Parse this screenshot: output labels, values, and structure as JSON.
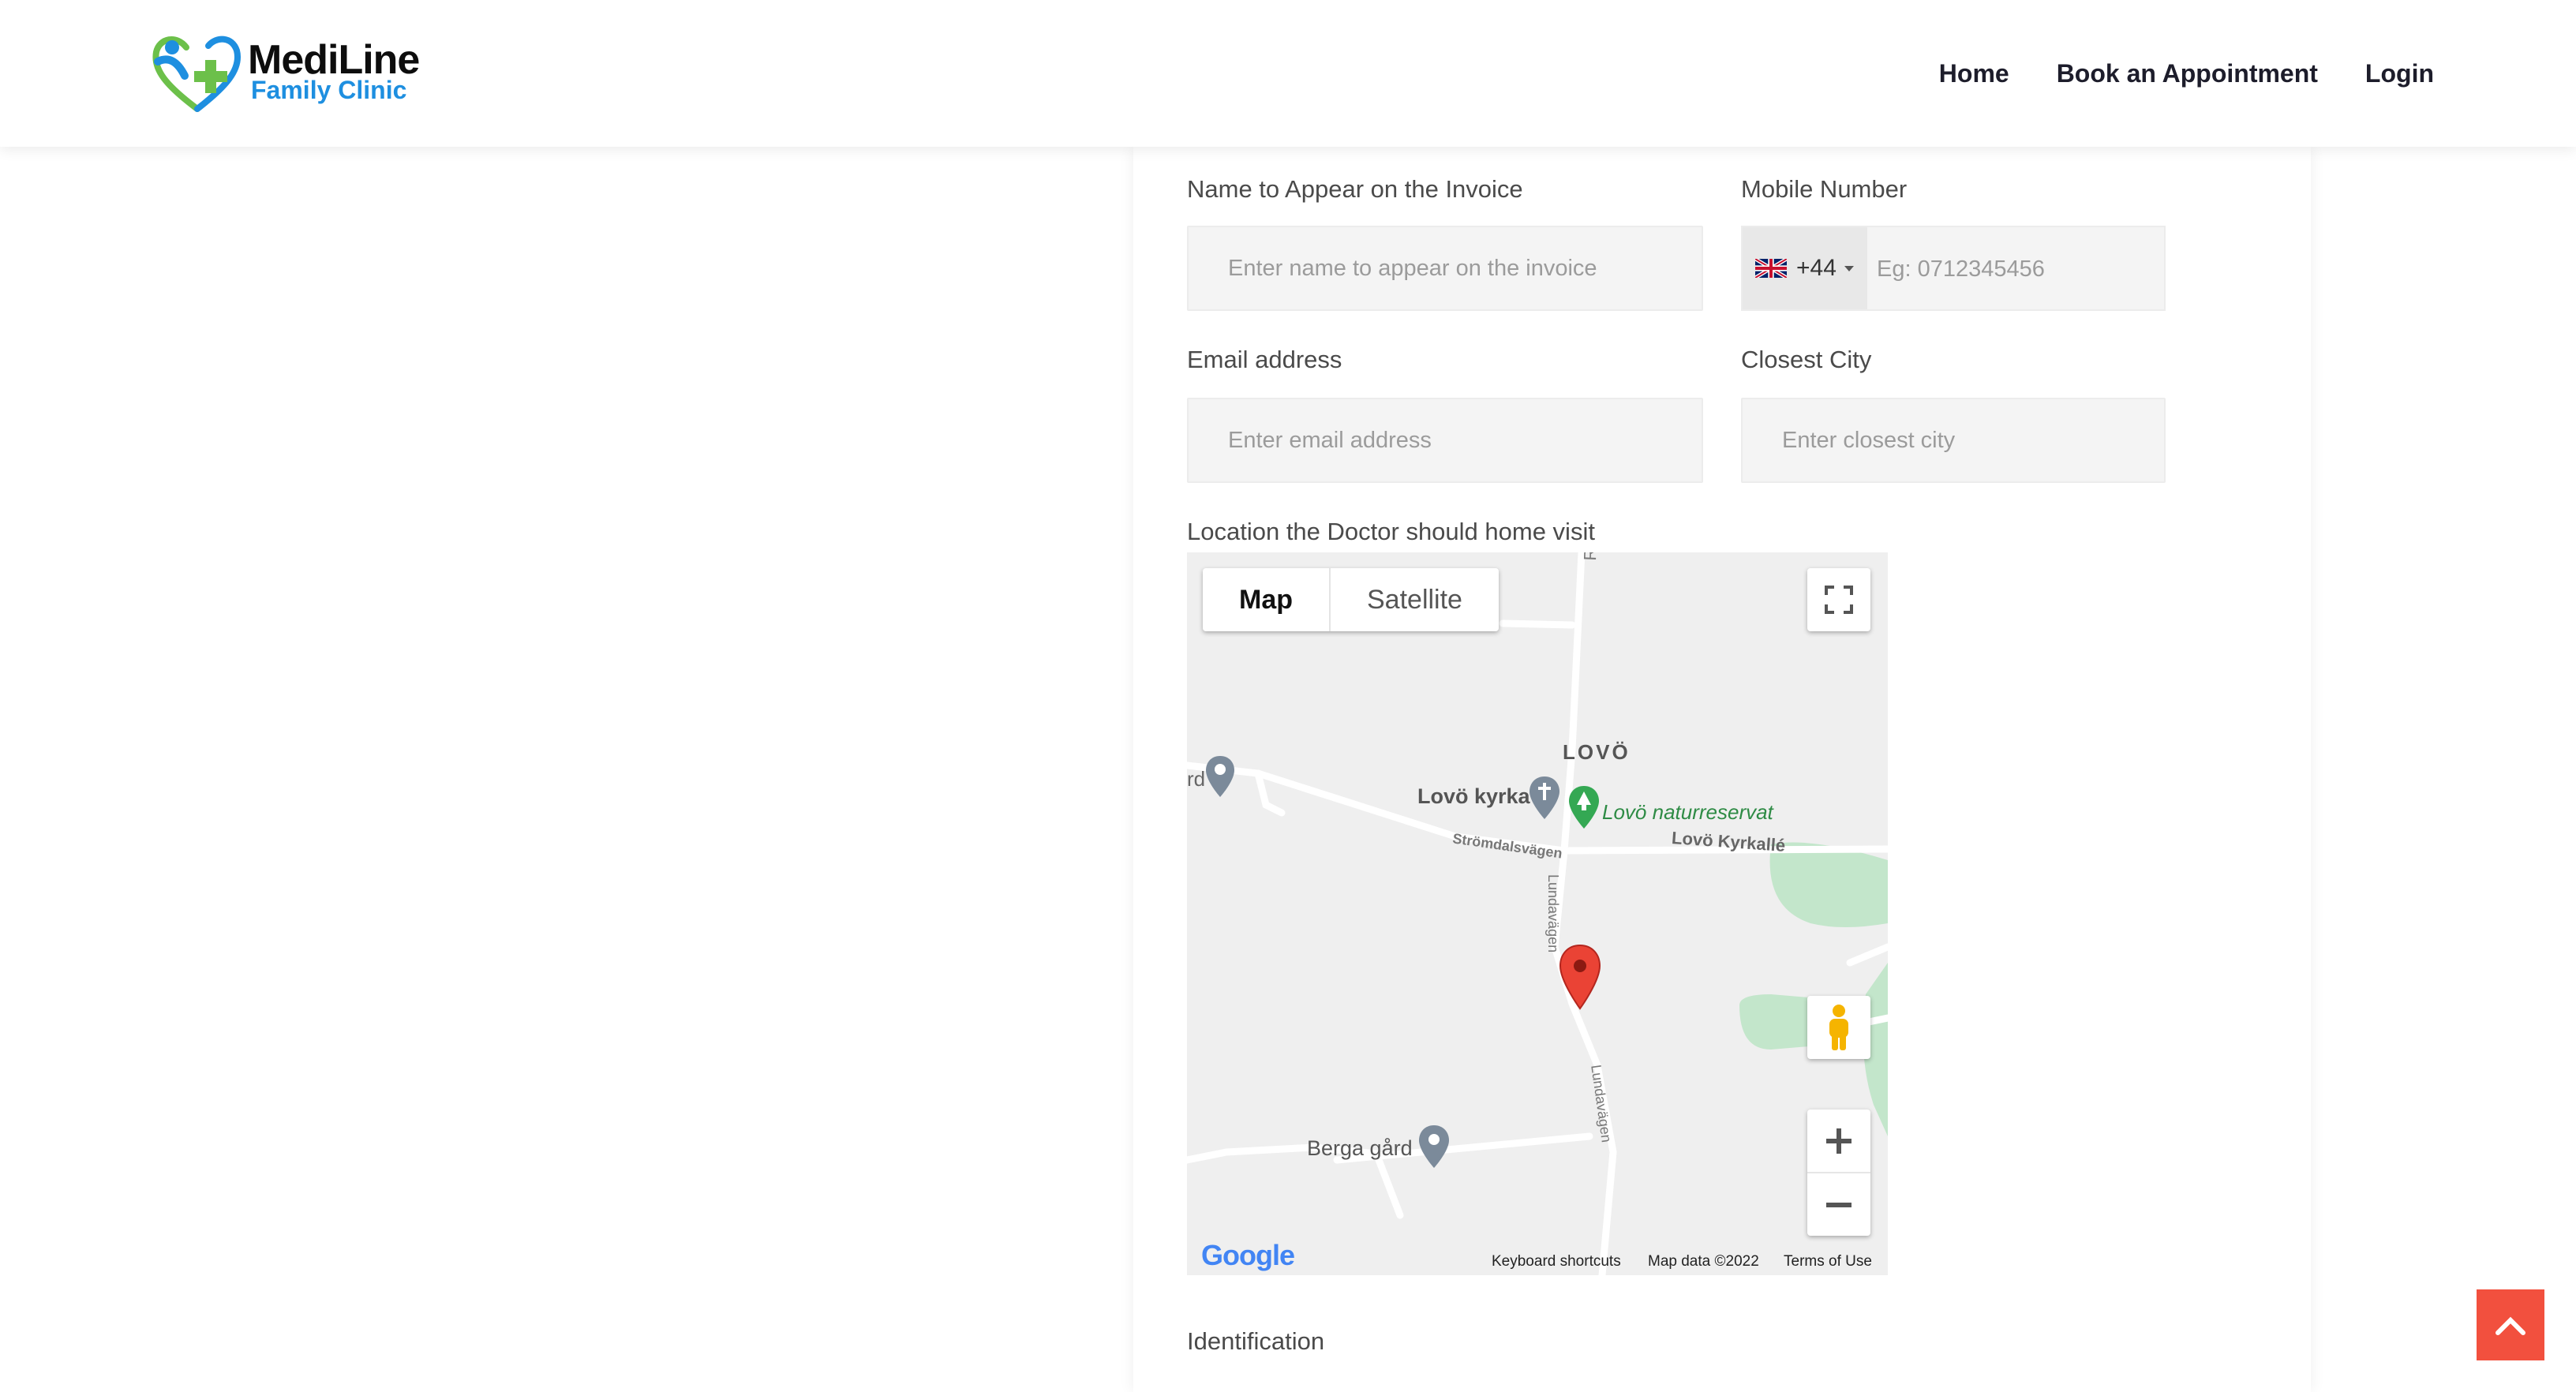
{
  "brand": {
    "title": "MediLine",
    "subtitle": "Family Clinic"
  },
  "nav": {
    "home": "Home",
    "book": "Book an Appointment",
    "login": "Login"
  },
  "form": {
    "invoice_name": {
      "label": "Name to Appear on the Invoice",
      "placeholder": "Enter name to appear on the invoice"
    },
    "mobile": {
      "label": "Mobile Number",
      "dial_code": "+44",
      "placeholder": "Eg: 0712345456"
    },
    "email": {
      "label": "Email address",
      "placeholder": "Enter email address"
    },
    "city": {
      "label": "Closest City",
      "placeholder": "Enter closest city"
    },
    "location": {
      "label": "Location the Doctor should home visit"
    },
    "identification": {
      "label": "Identification"
    }
  },
  "map": {
    "type_map": "Map",
    "type_satellite": "Satellite",
    "place_lovo": "LOVÖ",
    "place_church": "Lovö kyrka",
    "place_reserve": "Lovö naturreservat",
    "road_kyrkalle": "Lovö Kyrkallé",
    "road_stromdals": "Strömdalsvägen",
    "road_lunda_1": "Lundavägen",
    "road_lunda_2": "Lundavägen",
    "road_rort": "Rört",
    "place_berga": "Berga gård",
    "partial_label": "rd",
    "attribution_logo": "Google",
    "keyboard_shortcuts": "Keyboard shortcuts",
    "map_data": "Map data ©2022",
    "terms": "Terms of Use"
  },
  "colors": {
    "accent": "#f2503e",
    "brand_blue": "#1e8fe0",
    "brand_green": "#6cc04a",
    "park_green": "#c3e6cb"
  }
}
